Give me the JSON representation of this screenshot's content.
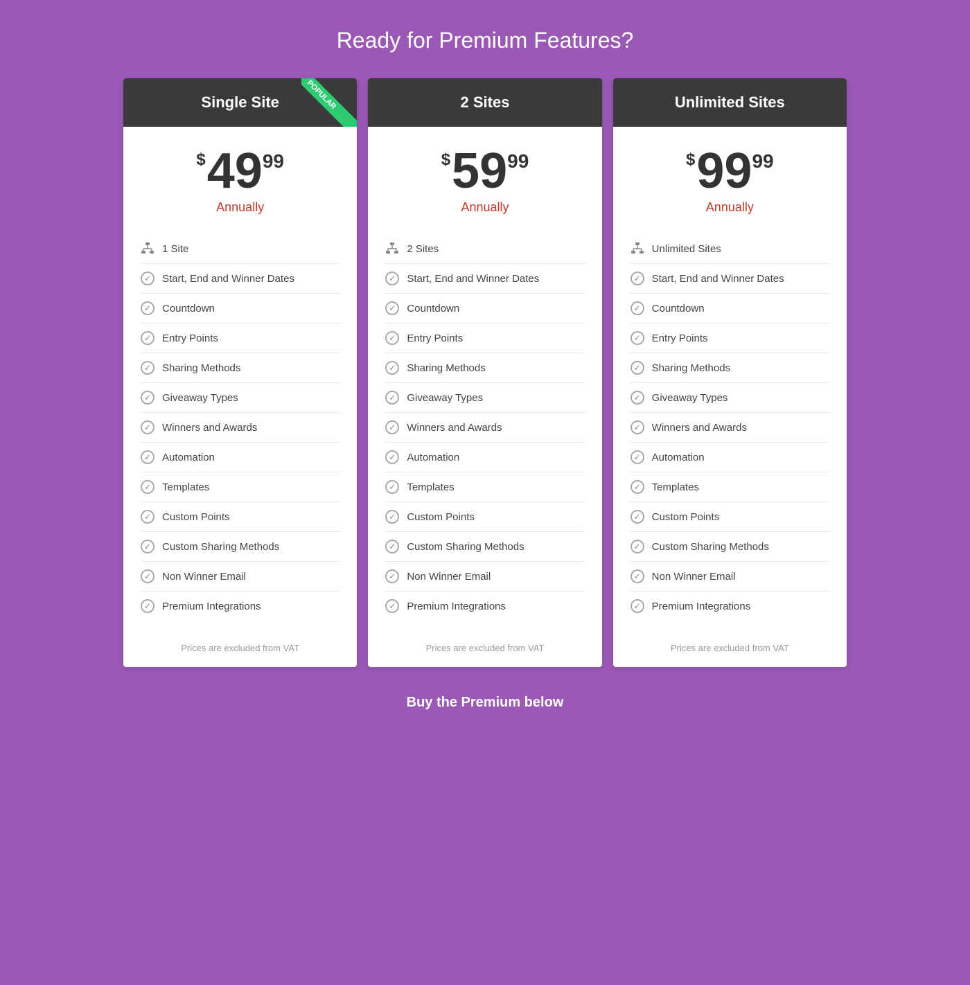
{
  "page": {
    "title": "Ready for Premium Features?",
    "buy_label": "Buy the Premium below"
  },
  "plans": [
    {
      "id": "single-site",
      "header": "Single Site",
      "is_popular": true,
      "popular_label": "POPULAR",
      "currency": "$",
      "amount": "49",
      "cents": "99",
      "billing": "Annually",
      "site_count": "1 Site",
      "features": [
        "Start, End and Winner Dates",
        "Countdown",
        "Entry Points",
        "Sharing Methods",
        "Giveaway Types",
        "Winners and Awards",
        "Automation",
        "Templates",
        "Custom Points",
        "Custom Sharing Methods",
        "Non Winner Email",
        "Premium Integrations"
      ],
      "vat_note": "Prices are excluded from VAT"
    },
    {
      "id": "two-sites",
      "header": "2 Sites",
      "is_popular": false,
      "popular_label": "",
      "currency": "$",
      "amount": "59",
      "cents": "99",
      "billing": "Annually",
      "site_count": "2 Sites",
      "features": [
        "Start, End and Winner Dates",
        "Countdown",
        "Entry Points",
        "Sharing Methods",
        "Giveaway Types",
        "Winners and Awards",
        "Automation",
        "Templates",
        "Custom Points",
        "Custom Sharing Methods",
        "Non Winner Email",
        "Premium Integrations"
      ],
      "vat_note": "Prices are excluded from VAT"
    },
    {
      "id": "unlimited-sites",
      "header": "Unlimited Sites",
      "is_popular": false,
      "popular_label": "",
      "currency": "$",
      "amount": "99",
      "cents": "99",
      "billing": "Annually",
      "site_count": "Unlimited Sites",
      "features": [
        "Start, End and Winner Dates",
        "Countdown",
        "Entry Points",
        "Sharing Methods",
        "Giveaway Types",
        "Winners and Awards",
        "Automation",
        "Templates",
        "Custom Points",
        "Custom Sharing Methods",
        "Non Winner Email",
        "Premium Integrations"
      ],
      "vat_note": "Prices are excluded from VAT"
    }
  ]
}
